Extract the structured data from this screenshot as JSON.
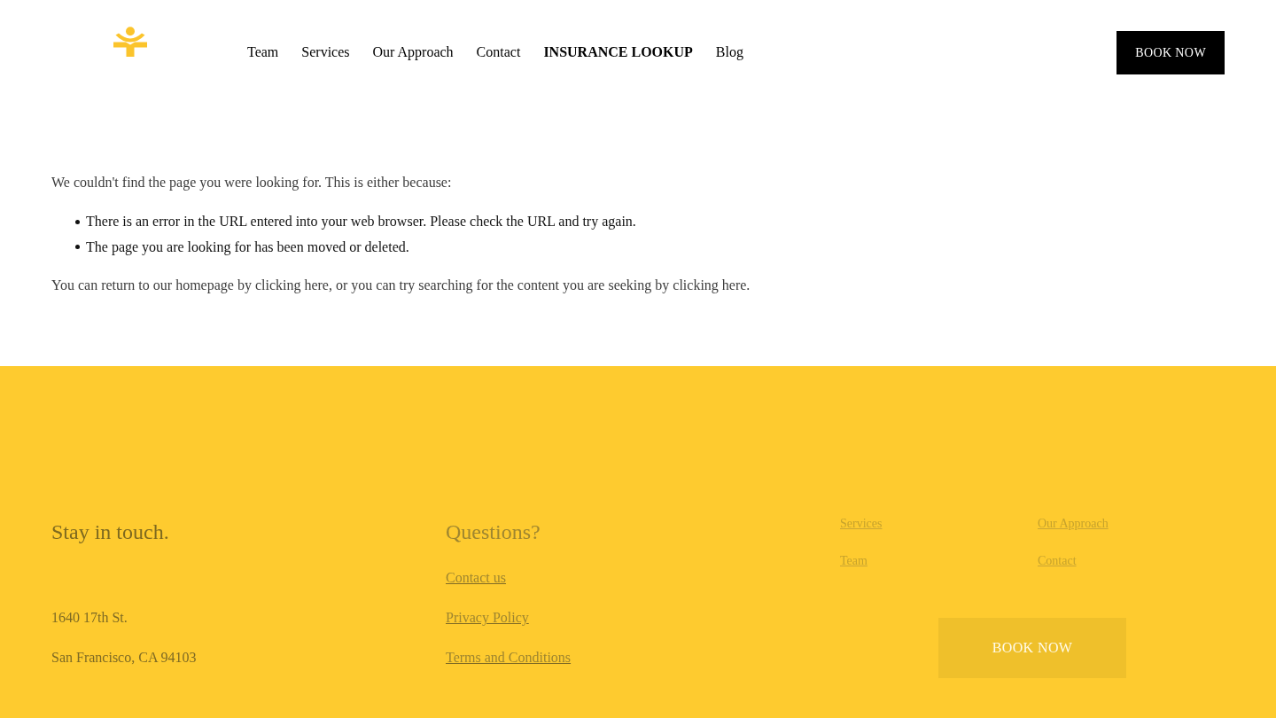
{
  "header": {
    "nav": [
      {
        "label": "Team",
        "selected": false
      },
      {
        "label": "Services",
        "selected": false
      },
      {
        "label": "Our Approach",
        "selected": false
      },
      {
        "label": "Contact",
        "selected": false
      },
      {
        "label": "INSURANCE LOOKUP",
        "selected": true
      },
      {
        "label": "Blog",
        "selected": false
      }
    ],
    "book_button": {
      "label": "BOOK NOW"
    }
  },
  "message": {
    "intro": "We couldn't find the page you were looking for. This is either because:",
    "reasons": [
      "There is an error in the URL entered into your web browser. Please check the URL and try again.",
      "The page you are looking for has been moved or deleted."
    ],
    "followup": {
      "lead": "You can return to our homepage by ",
      "homepage_link": "clicking here",
      "middle": ", or you can try searching for the content you are seeking by ",
      "search_link": "clicking here",
      "end": "."
    }
  },
  "footer": {
    "contact": {
      "heading": "Stay in touch.",
      "address_lines": [
        "1640 17th St.",
        "San Francisco, CA 94103"
      ]
    },
    "questions": {
      "heading": "Questions?",
      "links": [
        "Contact us",
        "Privacy Policy",
        "Terms and Conditions"
      ]
    },
    "site_links": [
      "Services",
      "Our Approach",
      "Team",
      "Contact"
    ],
    "book_button": {
      "label": "BOOK NOW"
    }
  }
}
